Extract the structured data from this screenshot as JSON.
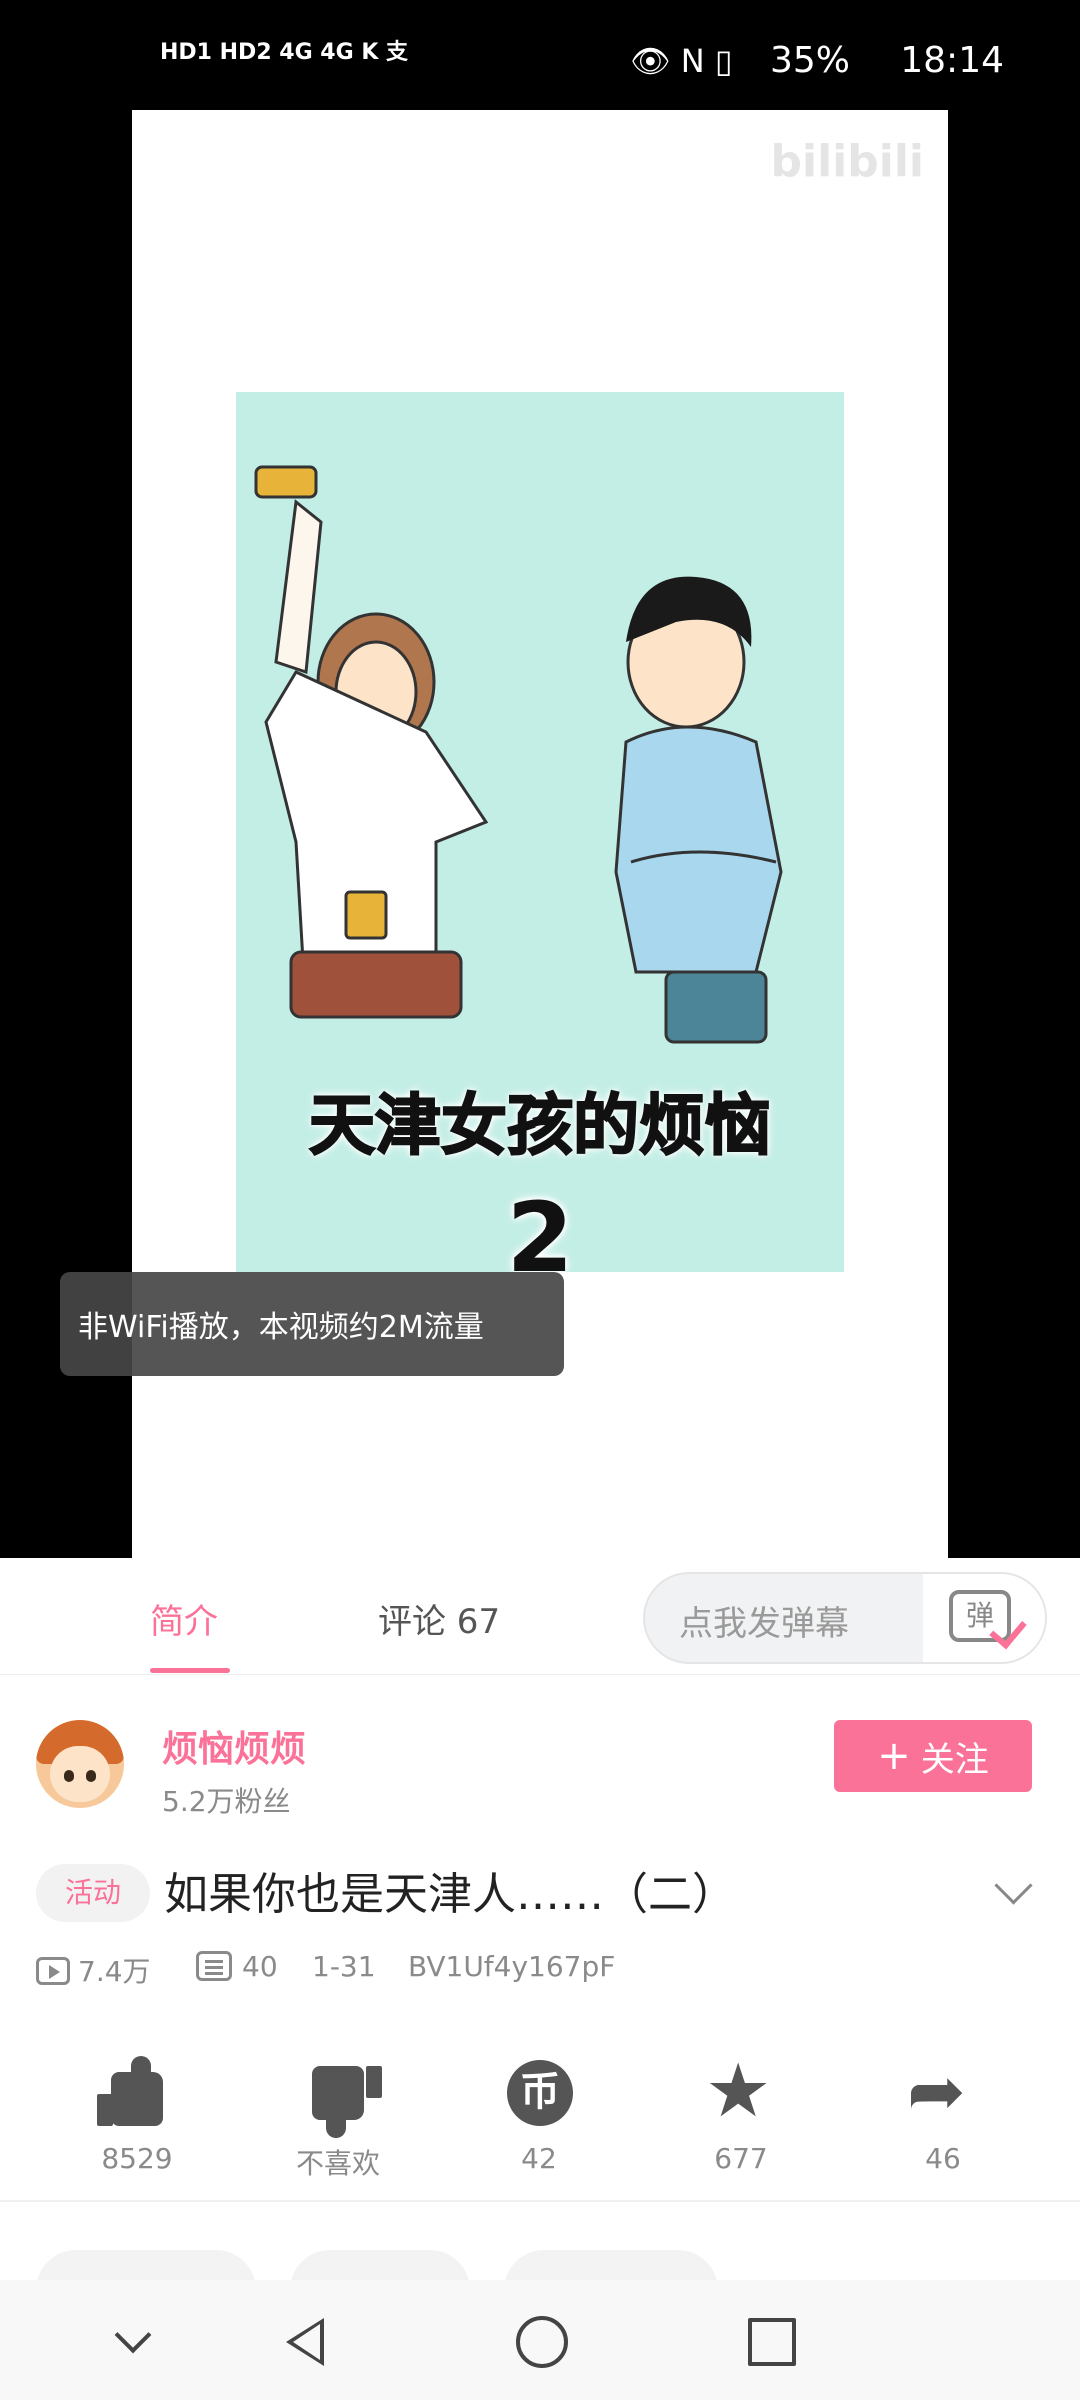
{
  "status_bar": {
    "left_indicators": "HD1 HD2 4G 4G K 支",
    "icons": "👁 N ▯",
    "battery": "35%",
    "time": "18:14"
  },
  "video": {
    "watermark": "bilibili",
    "title_text": "天津女孩的烦恼",
    "title_number": "2",
    "toast": "非WiFi播放，本视频约2M流量"
  },
  "tabs": {
    "intro": "简介",
    "comments": "评论 67",
    "danmaku_placeholder": "点我发弹幕",
    "danmaku_icon_text": "弹"
  },
  "author": {
    "name": "烦恼烦烦",
    "fans": "5.2万粉丝",
    "follow_label": "关注",
    "follow_plus": "+"
  },
  "video_info": {
    "badge": "活动",
    "title": "如果你也是天津人……（二）",
    "views": "7.4万",
    "danmaku_count": "40",
    "date": "1-31",
    "bvid": "BV1Uf4y167pF"
  },
  "actions": {
    "like": "8529",
    "dislike": "不喜欢",
    "coin": "42",
    "coin_glyph": "币",
    "favorite": "677",
    "favorite_glyph": "★",
    "share": "46",
    "share_glyph": "➦"
  },
  "colors": {
    "accent": "#fb7299",
    "video_bg": "#c3eee6"
  }
}
